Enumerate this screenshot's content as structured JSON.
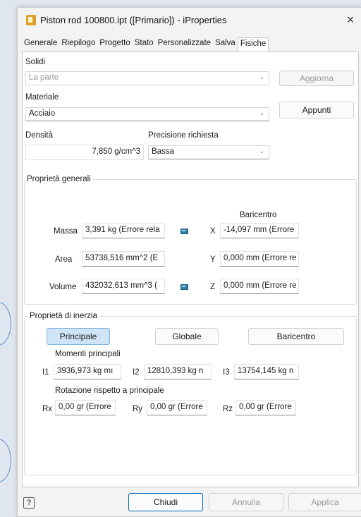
{
  "window": {
    "title": "Piston rod 100800.ipt ([Primario]) - iProperties",
    "close_icon": "×"
  },
  "tabs": [
    {
      "label": "Generale"
    },
    {
      "label": "Riepilogo"
    },
    {
      "label": "Progetto"
    },
    {
      "label": "Stato"
    },
    {
      "label": "Personalizzate"
    },
    {
      "label": "Salva"
    },
    {
      "label": "Fisiche",
      "active": true
    }
  ],
  "solids": {
    "label": "Solidi",
    "value": "La parte",
    "update_button": "Aggiorna"
  },
  "material": {
    "label": "Materiale",
    "value": "Acciaio",
    "notes_button": "Appunti"
  },
  "density": {
    "label": "Densità",
    "value": "7,850 g/cm^3"
  },
  "precision": {
    "label": "Precisione richiesta",
    "value": "Bassa"
  },
  "general": {
    "title": "Proprietà generali",
    "centroid_title": "Baricentro",
    "mass_label": "Massa",
    "mass_value": "3,391 kg (Errore rela",
    "area_label": "Area",
    "area_value": "53738,516 mm^2 (E",
    "volume_label": "Volume",
    "volume_value": "432032,613 mm^3 (",
    "x_label": "X",
    "x_value": "-14,097 mm (Errore",
    "y_label": "Y",
    "y_value": "0,000 mm (Errore re",
    "z_label": "Z",
    "z_value": "0,000 mm (Errore re"
  },
  "inertia": {
    "title": "Proprietà di inerzia",
    "btn_principal": "Principale",
    "btn_global": "Globale",
    "btn_centroid": "Baricentro",
    "moments_title": "Momenti principali",
    "i1_label": "I1",
    "i1_value": "3936,973 kg mı",
    "i2_label": "I2",
    "i2_value": "12810,393 kg n",
    "i3_label": "I3",
    "i3_value": "13754,145 kg n",
    "rotation_title": "Rotazione rispetto a principale",
    "rx_label": "Rx",
    "rx_value": "0,00 gr (Errore",
    "ry_label": "Ry",
    "ry_value": "0,00 gr (Errore",
    "rz_label": "Rz",
    "rz_value": "0,00 gr (Errore"
  },
  "footer": {
    "help_icon": "?",
    "close_button": "Chiudi",
    "cancel_button": "Annulla",
    "apply_button": "Applica"
  },
  "colors": {
    "accent": "#cfe4f8",
    "calc_icon": "#2f7ea8"
  }
}
